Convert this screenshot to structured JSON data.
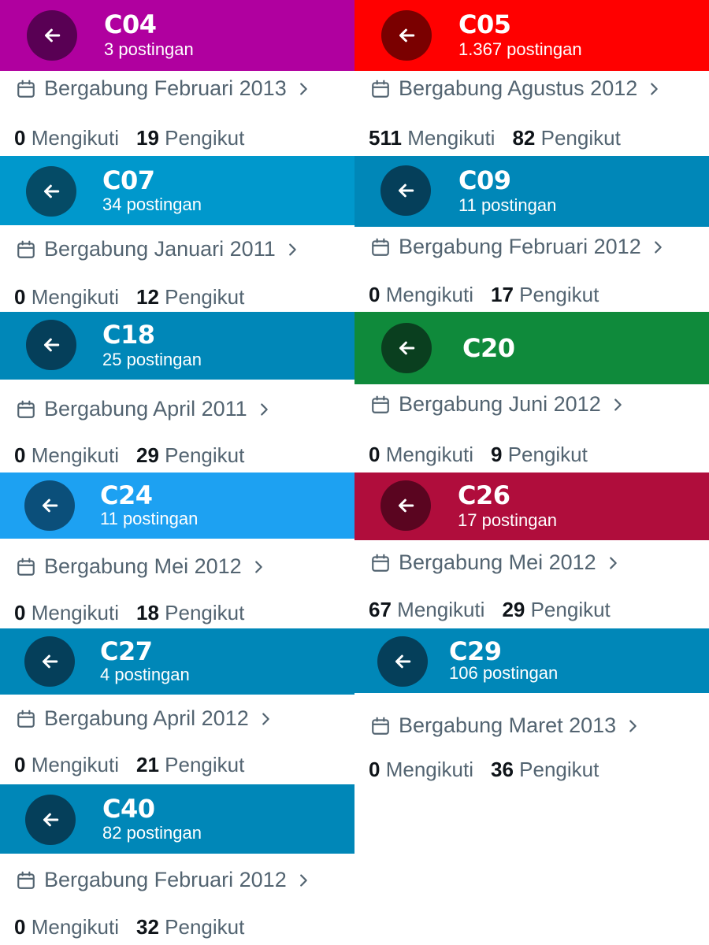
{
  "profiles": [
    {
      "name": "C04",
      "posts": "3 postingan",
      "joined": "Bergabung Februari 2013",
      "following": "0",
      "following_label": "Mengikuti",
      "followers": "19",
      "followers_label": "Pengikut",
      "header_color": "#b0009f",
      "button_color": "#590054"
    },
    {
      "name": "C05",
      "posts": "1.367 postingan",
      "joined": "Bergabung Agustus 2012",
      "following": "511",
      "following_label": "Mengikuti",
      "followers": "82",
      "followers_label": "Pengikut",
      "header_color": "#ff0000",
      "button_color": "#7a0000"
    },
    {
      "name": "C07",
      "posts": "34 postingan",
      "joined": "Bergabung Januari 2011",
      "following": "0",
      "following_label": "Mengikuti",
      "followers": "12",
      "followers_label": "Pengikut",
      "header_color": "#0098cc",
      "button_color": "#054b66"
    },
    {
      "name": "C09",
      "posts": "11 postingan",
      "joined": "Bergabung Februari 2012",
      "following": "0",
      "following_label": "Mengikuti",
      "followers": "17",
      "followers_label": "Pengikut",
      "header_color": "#0087b8",
      "button_color": "#053f5a"
    },
    {
      "name": "C18",
      "posts": "25 postingan",
      "joined": "Bergabung April 2011",
      "following": "0",
      "following_label": "Mengikuti",
      "followers": "29",
      "followers_label": "Pengikut",
      "header_color": "#0087b8",
      "button_color": "#053f5a"
    },
    {
      "name": "C20",
      "posts": "",
      "joined": "Bergabung Juni 2012",
      "following": "0",
      "following_label": "Mengikuti",
      "followers": "9",
      "followers_label": "Pengikut",
      "header_color": "#0f8a3b",
      "button_color": "#0a3f1f"
    },
    {
      "name": "C24",
      "posts": "11 postingan",
      "joined": "Bergabung Mei 2012",
      "following": "0",
      "following_label": "Mengikuti",
      "followers": "18",
      "followers_label": "Pengikut",
      "header_color": "#1da1f2",
      "button_color": "#0b4f7a"
    },
    {
      "name": "C26",
      "posts": "17 postingan",
      "joined": "Bergabung Mei 2012",
      "following": "67",
      "following_label": "Mengikuti",
      "followers": "29",
      "followers_label": "Pengikut",
      "header_color": "#b00d3c",
      "button_color": "#5a0520"
    },
    {
      "name": "C27",
      "posts": "4 postingan",
      "joined": "Bergabung April 2012",
      "following": "0",
      "following_label": "Mengikuti",
      "followers": "21",
      "followers_label": "Pengikut",
      "header_color": "#0087b8",
      "button_color": "#053f5a"
    },
    {
      "name": "C29",
      "posts": "106 postingan",
      "joined": "Bergabung Maret 2013",
      "following": "0",
      "following_label": "Mengikuti",
      "followers": "36",
      "followers_label": "Pengikut",
      "header_color": "#0087b8",
      "button_color": "#053f5a"
    },
    {
      "name": "C40",
      "posts": "82 postingan",
      "joined": "Bergabung Februari 2012",
      "following": "0",
      "following_label": "Mengikuti",
      "followers": "32",
      "followers_label": "Pengikut",
      "header_color": "#0087b8",
      "button_color": "#053f5a"
    }
  ]
}
